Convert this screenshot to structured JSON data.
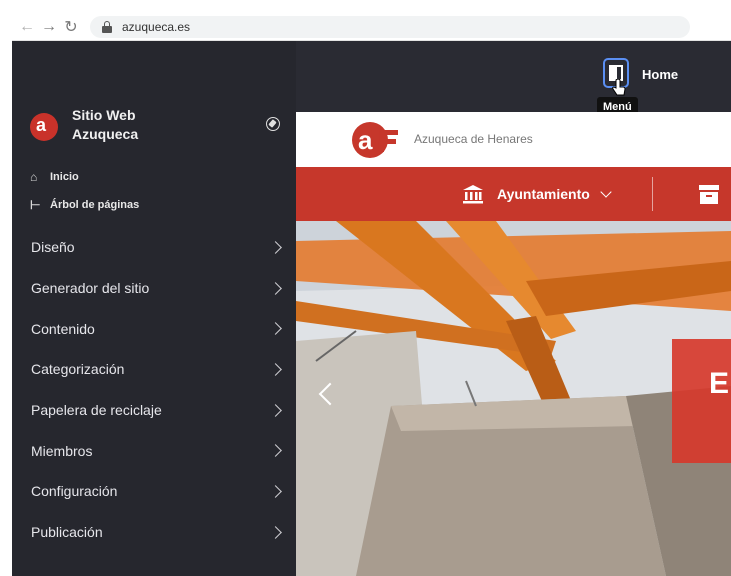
{
  "browser": {
    "url": "azuqueca.es"
  },
  "sidebar": {
    "site_title_line1": "Sitio Web",
    "site_title_line2": "Azuqueca",
    "quick_links": [
      {
        "label": "Inicio",
        "icon": "home-icon"
      },
      {
        "label": "Árbol de páginas",
        "icon": "page-tree-icon"
      }
    ],
    "menu": [
      {
        "label": "Diseño"
      },
      {
        "label": "Generador del sitio"
      },
      {
        "label": "Contenido"
      },
      {
        "label": "Categorización"
      },
      {
        "label": "Papelera de reciclaje"
      },
      {
        "label": "Miembros"
      },
      {
        "label": "Configuración"
      },
      {
        "label": "Publicación"
      }
    ]
  },
  "topbar": {
    "home_label": "Home",
    "tooltip": "Menú"
  },
  "site": {
    "brand_name": "Azuqueca de Henares",
    "nav_item": "Ayuntamiento",
    "hero_letter": "E"
  },
  "colors": {
    "sidebar_bg": "#26272e",
    "topbar_bg": "#2a2b33",
    "brand_red": "#c6372b",
    "focus_blue": "#5b8ff2"
  }
}
